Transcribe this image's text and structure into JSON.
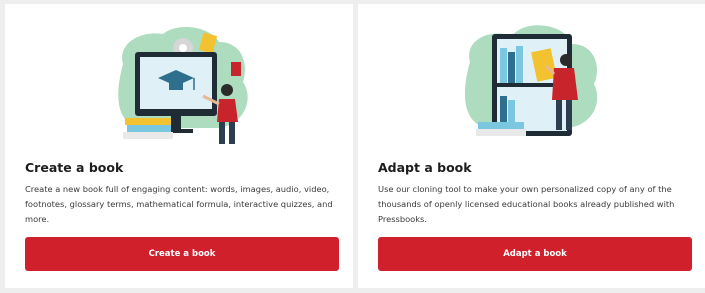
{
  "cards": [
    {
      "title": "Create a book",
      "description": "Create a new book full of engaging content: words, images, audio, video, footnotes, glossary terms, mathematical formula, interactive quizzes, and more.",
      "button_label": "Create a book",
      "illustration": "teacher-at-monitor-illustration"
    },
    {
      "title": "Adapt a book",
      "description": "Use our cloning tool to make your own personalized copy of any of the thousands of openly licensed educational books already published with Pressbooks.",
      "button_label": "Adapt a book",
      "illustration": "person-at-bookshelf-illustration"
    }
  ],
  "colors": {
    "button": "#d0202c",
    "background": "#eeeeee",
    "card": "#ffffff"
  }
}
